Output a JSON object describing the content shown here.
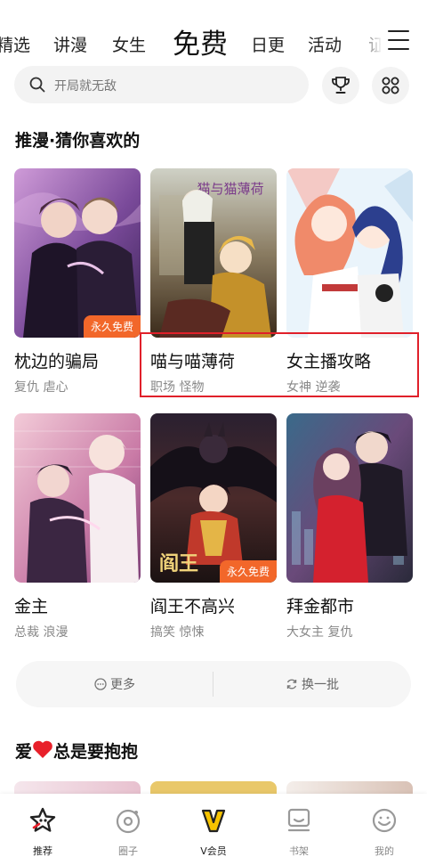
{
  "tabs": [
    "精选",
    "讲漫",
    "女生",
    "免费",
    "日更",
    "活动",
    "证"
  ],
  "active_tab": "免费",
  "search": {
    "placeholder": "开局就无敌"
  },
  "section1": {
    "title": "推漫·猜你喜欢的",
    "cards": [
      {
        "title": "枕边的骗局",
        "tags": "复仇 虐心",
        "badge": "永久免费"
      },
      {
        "title": "喵与喵薄荷",
        "tags": "职场 怪物",
        "badge": ""
      },
      {
        "title": "女主播攻略",
        "tags": "女神 逆袭",
        "badge": ""
      },
      {
        "title": "金主",
        "tags": "总裁 浪漫",
        "badge": ""
      },
      {
        "title": "阎王不高兴",
        "tags": "搞笑 惊悚",
        "badge": "永久免费"
      },
      {
        "title": "拜金都市",
        "tags": "大女主 复仇",
        "badge": ""
      }
    ]
  },
  "actions": {
    "more": "更多",
    "refresh": "换一批"
  },
  "section2": {
    "title_prefix": "爱",
    "title_suffix": "总是要抱抱"
  },
  "bottom_nav": [
    {
      "label": "推荐",
      "icon": "star-icon",
      "active": true
    },
    {
      "label": "圈子",
      "icon": "circle-icon",
      "active": false
    },
    {
      "label": "V会员",
      "icon": "vip-icon",
      "active": false
    },
    {
      "label": "书架",
      "icon": "bookshelf-icon",
      "active": false
    },
    {
      "label": "我的",
      "icon": "profile-icon",
      "active": false
    }
  ],
  "colors": {
    "badge": "#f2672a",
    "highlight": "#e0202a",
    "vip": "#f7c400",
    "heart": "#e8202a"
  }
}
